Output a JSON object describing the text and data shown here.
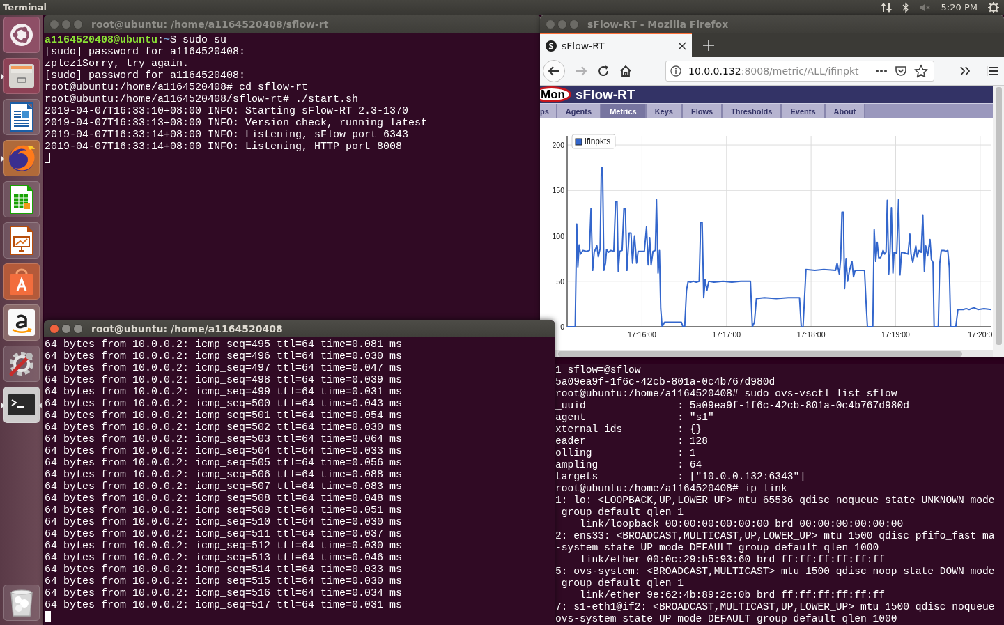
{
  "top_bar": {
    "app_name": "Terminal",
    "clock": "5:20 PM"
  },
  "launcher": [
    {
      "kind": "dash",
      "running": false,
      "active": false
    },
    {
      "kind": "files",
      "running": true,
      "active": false
    },
    {
      "kind": "writer",
      "running": false,
      "active": false
    },
    {
      "kind": "firefox",
      "running": true,
      "active": false
    },
    {
      "kind": "calc",
      "running": false,
      "active": false
    },
    {
      "kind": "impress",
      "running": false,
      "active": false
    },
    {
      "kind": "software",
      "running": false,
      "active": false
    },
    {
      "kind": "amazon",
      "running": false,
      "active": false
    },
    {
      "kind": "settings",
      "running": false,
      "active": false
    },
    {
      "kind": "terminal",
      "running": true,
      "active": true
    },
    {
      "kind": "trash",
      "running": false,
      "active": false
    }
  ],
  "terminal_1": {
    "title": "root@ubuntu: /home/a1164520408/sflow-rt",
    "focused": false,
    "lines": [
      {
        "kind": "prompt",
        "user": "a1164520408@ubuntu",
        "separator": ":",
        "path": "~",
        "command": "$ sudo su"
      },
      {
        "kind": "plain",
        "text": "[sudo] password for a1164520408:"
      },
      {
        "kind": "plain",
        "text": "zplcz1Sorry, try again."
      },
      {
        "kind": "plain",
        "text": "[sudo] password for a1164520408:"
      },
      {
        "kind": "plain",
        "text": "root@ubuntu:/home/a1164520408# cd sflow-rt"
      },
      {
        "kind": "plain",
        "text": "root@ubuntu:/home/a1164520408/sflow-rt# ./start.sh"
      },
      {
        "kind": "plain",
        "text": "2019-04-07T16:33:10+08:00 INFO: Starting sFlow-RT 2.3-1370"
      },
      {
        "kind": "plain",
        "text": "2019-04-07T16:33:13+08:00 INFO: Version check, running latest"
      },
      {
        "kind": "plain",
        "text": "2019-04-07T16:33:14+08:00 INFO: Listening, sFlow port 6343"
      },
      {
        "kind": "plain",
        "text": "2019-04-07T16:33:14+08:00 INFO: Listening, HTTP port 8008"
      }
    ]
  },
  "terminal_3": {
    "lines": [
      "1 sflow=@sflow",
      "5a09ea9f-1f6c-42cb-801a-0c4b767d980d",
      "root@ubuntu:/home/a1164520408# sudo ovs-vsctl list sflow",
      "_uuid               : 5a09ea9f-1f6c-42cb-801a-0c4b767d980d",
      "agent               : \"s1\"",
      "xternal_ids         : {}",
      "eader               : 128",
      "olling              : 1",
      "ampling             : 64",
      "targets             : [\"10.0.0.132:6343\"]",
      "root@ubuntu:/home/a1164520408# ip link",
      "1: lo: <LOOPBACK,UP,LOWER_UP> mtu 65536 qdisc noqueue state UNKNOWN mode",
      " group default qlen 1",
      "    link/loopback 00:00:00:00:00:00 brd 00:00:00:00:00:00",
      "2: ens33: <BROADCAST,MULTICAST,UP,LOWER_UP> mtu 1500 qdisc pfifo_fast ma",
      "-system state UP mode DEFAULT group default qlen 1000",
      "    link/ether 00:0c:29:b5:93:60 brd ff:ff:ff:ff:ff:ff",
      "5: ovs-system: <BROADCAST,MULTICAST> mtu 1500 qdisc noop state DOWN mode",
      " group default qlen 1",
      "    link/ether 9e:62:4b:89:2c:0b brd ff:ff:ff:ff:ff:ff",
      "7: s1-eth1@if2: <BROADCAST,MULTICAST,UP,LOWER_UP> mtu 1500 qdisc noqueue",
      "ovs-system state UP mode DEFAULT group default qlen 1000"
    ]
  },
  "firefox": {
    "title": "sFlow-RT - Mozilla Firefox",
    "focused": false,
    "tabs": [
      {
        "label": "sFlow-RT",
        "selected": true
      }
    ],
    "url_host": "10.0.0.132",
    "url_rest": ":8008/metric/ALL/ifinpkt",
    "page": {
      "logo": "Mon",
      "site_title": "sFlow-RT",
      "nav": [
        {
          "label": "ps",
          "selected": false
        },
        {
          "label": "Agents",
          "selected": false
        },
        {
          "label": "Metrics",
          "selected": true
        },
        {
          "label": "Keys",
          "selected": false
        },
        {
          "label": "Flows",
          "selected": false
        },
        {
          "label": "Thresholds",
          "selected": false
        },
        {
          "label": "Events",
          "selected": false
        },
        {
          "label": "About",
          "selected": false
        }
      ],
      "chart": {
        "chart_data": {
          "type": "line",
          "grid": true,
          "xlim": [
            62106.9,
            62408
          ],
          "ylim": [
            0,
            210
          ],
          "yticks": [
            0,
            50,
            100,
            150,
            200
          ],
          "xticks": [
            {
              "value": 62160,
              "label": "17:16:00"
            },
            {
              "value": 62220,
              "label": "17:17:00"
            },
            {
              "value": 62280,
              "label": "17:18:00"
            },
            {
              "value": 62340,
              "label": "17:19:00"
            },
            {
              "value": 62400,
              "label": "17:20:0"
            }
          ],
          "x": [
            62106.9,
            62112.6,
            62113.7,
            62114.5,
            62115.4,
            62116.4,
            62118.1,
            62120.6,
            62122.7,
            62123.8,
            62125.0,
            62126.1,
            62128.0,
            62129.0,
            62130.3,
            62131.2,
            62132.0,
            62133.0,
            62134.1,
            62134.9,
            62136.2,
            62137.9,
            62140.0,
            62141.3,
            62142.3,
            62143.2,
            62144.2,
            62145.9,
            62147.2,
            62148.2,
            62149.3,
            62150.9,
            62152.2,
            62153.3,
            62154.7,
            62156.2,
            62157.3,
            62159.6,
            62161.7,
            62163.2,
            62164.4,
            62165.5,
            62166.5,
            62167.8,
            62169.5,
            62170.3,
            62171.4,
            62172.4,
            62173.3,
            62174.3,
            62176.0,
            62188.0,
            62189.0,
            62190.3,
            62191.6,
            62192.8,
            62194.3,
            62196.4,
            62198.5,
            62200.6,
            62201.7,
            62202.7,
            62203.8,
            62204.8,
            62206.1,
            62207.4,
            62211.1,
            62217.5,
            62223.8,
            62230.1,
            62237.0,
            62238.3,
            62239.8,
            62241.2,
            62246.9,
            62255.3,
            62263.8,
            62271.8,
            62273.0,
            62274.3,
            62276.4,
            62282.7,
            62289.0,
            62297.4,
            62298.5,
            62300.0,
            62301.0,
            62301.9,
            62302.9,
            62303.8,
            62304.8,
            62305.9,
            62307.3,
            62309.0,
            62310.1,
            62311.3,
            62314.3,
            62317.9,
            62318.9,
            62320.0,
            62323.8,
            62324.8,
            62325.9,
            62326.9,
            62328.0,
            62329.4,
            62331.1,
            62332.2,
            62333.2,
            62334.1,
            62335.1,
            62336.0,
            62337.0,
            62338.1,
            62338.9,
            62340.8,
            62342.1,
            62343.1,
            62344.2,
            62346.9,
            62348.8,
            62350.1,
            62350.9,
            62352.2,
            62354.3,
            62355.3,
            62356.6,
            62358.1,
            62359.3,
            62360.4,
            62361.4,
            62362.7,
            62364.4,
            62365.4,
            62366.5,
            62367.3,
            62370.3,
            62371.3,
            62372.4,
            62374.3,
            62375.8,
            62377.0,
            62378.1,
            62379.1,
            62382.7,
            62384.2,
            62388.0,
            62390.1,
            62392.2,
            62395.5,
            62398.5,
            62402.7,
            62408.0
          ],
          "series": [
            {
              "name": "ifinpkts",
              "color": "#3366cc",
              "values": [
                0,
                0,
                113,
                66,
                90,
                80,
                84,
                83,
                84,
                130,
                62,
                82,
                89,
                77,
                86,
                175,
                175,
                62,
                70,
                85,
                82,
                84,
                83,
                138,
                138,
                61,
                83,
                84,
                130,
                130,
                62,
                103,
                103,
                70,
                100,
                70,
                83,
                83,
                83,
                110,
                68,
                98,
                68,
                83,
                84,
                140,
                59,
                84,
                20,
                0,
                5,
                5,
                0,
                0,
                40,
                50,
                49,
                50,
                49,
                50,
                115,
                115,
                32,
                52,
                40,
                50,
                49,
                50,
                49,
                50,
                50,
                0,
                5,
                31,
                32,
                31,
                32,
                32,
                0,
                0,
                63,
                62,
                63,
                62,
                70,
                58,
                75,
                126,
                126,
                42,
                75,
                50,
                62,
                72,
                55,
                62,
                62,
                62,
                30,
                0,
                0,
                107,
                72,
                93,
                76,
                76,
                84,
                80,
                82,
                139,
                58,
                83,
                131,
                59,
                82,
                81,
                140,
                57,
                82,
                81,
                80,
                102,
                80,
                71,
                89,
                77,
                84,
                82,
                123,
                61,
                89,
                78,
                96,
                74,
                71,
                0,
                0,
                70,
                84,
                84,
                83,
                84,
                65,
                0,
                0,
                19,
                19,
                20,
                19,
                21,
                19,
                20,
                19
              ]
            }
          ]
        }
      }
    }
  },
  "terminal_2": {
    "title": "root@ubuntu: /home/a1164520408",
    "focused": true,
    "lines": [
      "64 bytes from 10.0.0.2: icmp_seq=495 ttl=64 time=0.081 ms",
      "64 bytes from 10.0.0.2: icmp_seq=496 ttl=64 time=0.030 ms",
      "64 bytes from 10.0.0.2: icmp_seq=497 ttl=64 time=0.047 ms",
      "64 bytes from 10.0.0.2: icmp_seq=498 ttl=64 time=0.039 ms",
      "64 bytes from 10.0.0.2: icmp_seq=499 ttl=64 time=0.031 ms",
      "64 bytes from 10.0.0.2: icmp_seq=500 ttl=64 time=0.043 ms",
      "64 bytes from 10.0.0.2: icmp_seq=501 ttl=64 time=0.054 ms",
      "64 bytes from 10.0.0.2: icmp_seq=502 ttl=64 time=0.030 ms",
      "64 bytes from 10.0.0.2: icmp_seq=503 ttl=64 time=0.064 ms",
      "64 bytes from 10.0.0.2: icmp_seq=504 ttl=64 time=0.033 ms",
      "64 bytes from 10.0.0.2: icmp_seq=505 ttl=64 time=0.056 ms",
      "64 bytes from 10.0.0.2: icmp_seq=506 ttl=64 time=0.088 ms",
      "64 bytes from 10.0.0.2: icmp_seq=507 ttl=64 time=0.083 ms",
      "64 bytes from 10.0.0.2: icmp_seq=508 ttl=64 time=0.048 ms",
      "64 bytes from 10.0.0.2: icmp_seq=509 ttl=64 time=0.051 ms",
      "64 bytes from 10.0.0.2: icmp_seq=510 ttl=64 time=0.030 ms",
      "64 bytes from 10.0.0.2: icmp_seq=511 ttl=64 time=0.037 ms",
      "64 bytes from 10.0.0.2: icmp_seq=512 ttl=64 time=0.030 ms",
      "64 bytes from 10.0.0.2: icmp_seq=513 ttl=64 time=0.046 ms",
      "64 bytes from 10.0.0.2: icmp_seq=514 ttl=64 time=0.033 ms",
      "64 bytes from 10.0.0.2: icmp_seq=515 ttl=64 time=0.030 ms",
      "64 bytes from 10.0.0.2: icmp_seq=516 ttl=64 time=0.034 ms",
      "64 bytes from 10.0.0.2: icmp_seq=517 ttl=64 time=0.031 ms"
    ]
  }
}
